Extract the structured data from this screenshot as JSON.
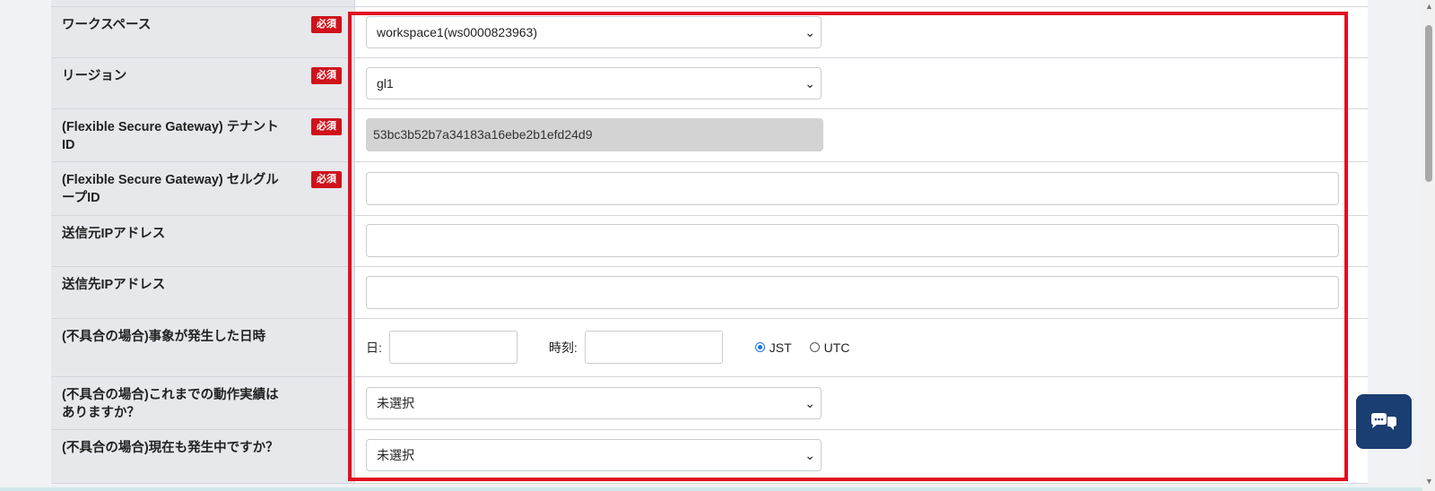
{
  "required_badge": "必須",
  "rows": {
    "workspace": {
      "label": "ワークスペース",
      "value": "workspace1(ws0000823963)"
    },
    "region": {
      "label": "リージョン",
      "value": "gl1"
    },
    "tenant_id": {
      "label": "(Flexible Secure Gateway) テナントID",
      "value": "53bc3b52b7a34183a16ebe2b1efd24d9"
    },
    "cell_group_id": {
      "label": "(Flexible Secure Gateway) セルグループID",
      "value": ""
    },
    "source_ip": {
      "label": "送信元IPアドレス",
      "value": ""
    },
    "dest_ip": {
      "label": "送信先IPアドレス",
      "value": ""
    },
    "occurred_at": {
      "label": "(不具合の場合)事象が発生した日時",
      "date_label": "日:",
      "time_label": "時刻:",
      "tz_options": [
        "JST",
        "UTC"
      ],
      "tz_selected": "JST"
    },
    "past_operation": {
      "label": "(不具合の場合)これまでの動作実績はありますか？",
      "value": "未選択"
    },
    "still_occurring": {
      "label": "(不具合の場合)現在も発生中ですか？",
      "value": "未選択"
    }
  },
  "icons": {
    "chevron": "chevron-down-icon",
    "chat": "chat-support-icon"
  },
  "colors": {
    "highlight": "#e01020",
    "required_badge": "#d0121b",
    "chat_button": "#1a3d72",
    "radio_selected": "#1a73e8"
  }
}
